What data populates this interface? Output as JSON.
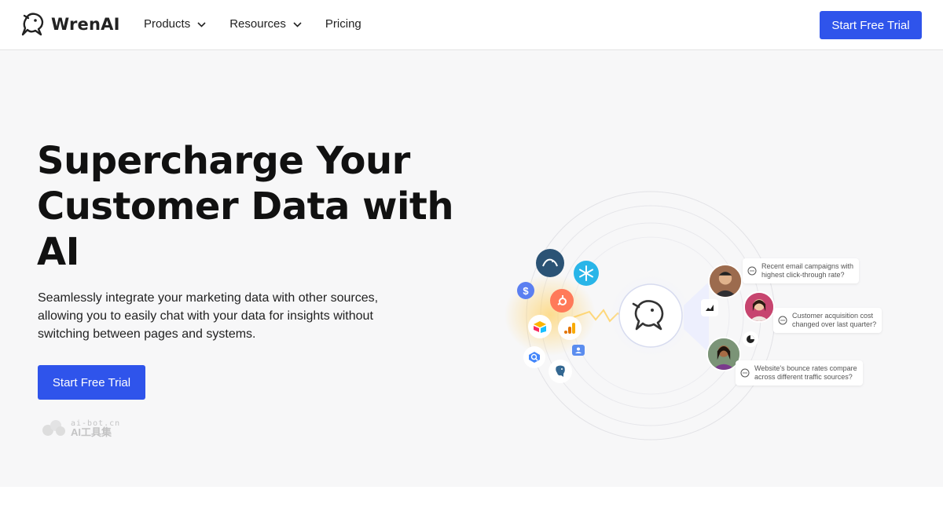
{
  "header": {
    "brand": "WrenAI",
    "nav": [
      {
        "label": "Products",
        "has_dropdown": true
      },
      {
        "label": "Resources",
        "has_dropdown": true
      },
      {
        "label": "Pricing",
        "has_dropdown": false
      }
    ],
    "cta_label": "Start Free Trial"
  },
  "hero": {
    "title_lines": [
      "Supercharge Your",
      "Customer Data with",
      "AI"
    ],
    "subtitle_lines": [
      "Seamlessly integrate your marketing data with other sources,",
      "allowing you to easily chat with your data for insights without",
      "switching between pages and systems."
    ],
    "cta_label": "Start Free Trial"
  },
  "watermark": {
    "url": "ai-bot.cn",
    "name": "AI工具集"
  },
  "illustration": {
    "questions": [
      {
        "line1": "Recent email campaigns with",
        "line2": "highest click-through rate?"
      },
      {
        "line1": "Customer acquisition cost",
        "line2": "changed over last quarter?"
      },
      {
        "line1": "Website's bounce rates compare",
        "line2": "across different traffic sources?"
      }
    ],
    "source_icons": [
      "mysql-icon",
      "snowflake-icon",
      "dollar-icon",
      "hubspot-icon",
      "airtable-icon",
      "google-analytics-icon",
      "bigquery-icon",
      "user-card-icon",
      "postgres-icon"
    ]
  },
  "colors": {
    "accent": "#2f54eb",
    "hero_bg": "#f7f7f8"
  }
}
